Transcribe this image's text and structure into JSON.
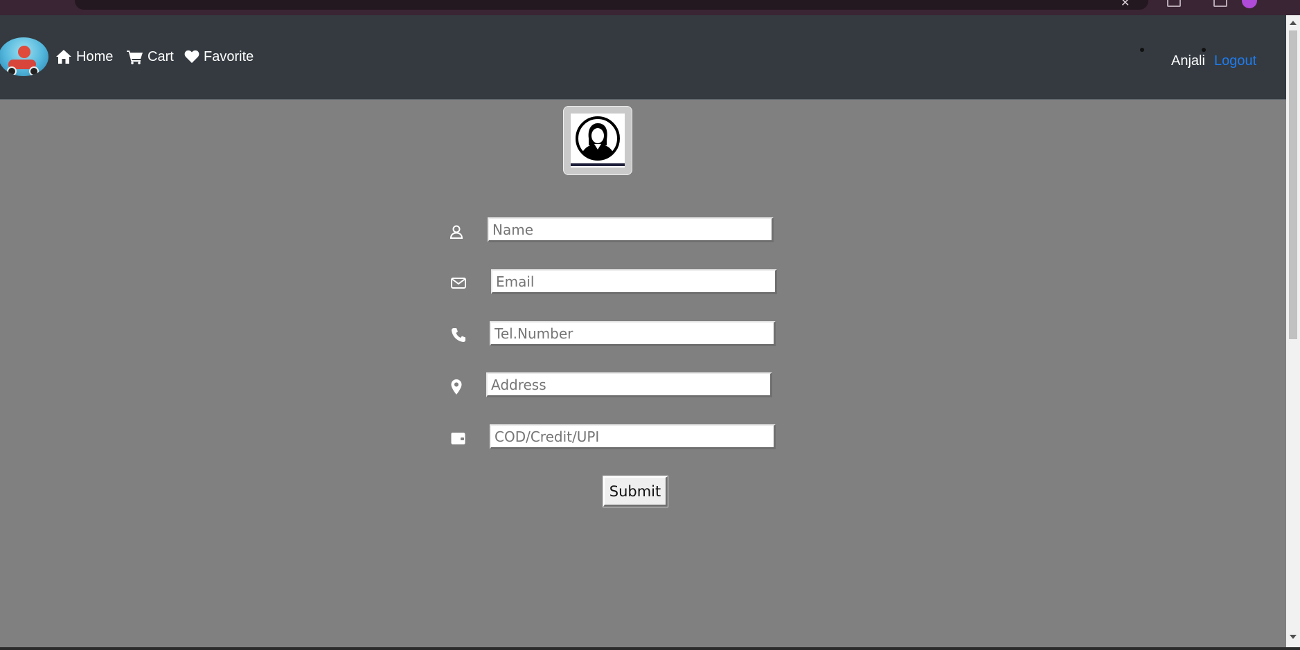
{
  "nav": {
    "home_label": "Home",
    "cart_label": "Cart",
    "favorite_label": "Favorite",
    "user_name": "Anjali",
    "logout_label": "Logout"
  },
  "form": {
    "name_placeholder": "Name",
    "email_placeholder": "Email",
    "phone_placeholder": "Tel.Number",
    "address_placeholder": "Address",
    "payment_placeholder": "COD/Credit/UPI",
    "submit_label": "Submit"
  },
  "icons": {
    "home": "home-icon",
    "cart": "cart-icon",
    "favorite": "heart-icon",
    "name": "user-icon",
    "email": "envelope-icon",
    "phone": "phone-icon",
    "address": "map-pin-icon",
    "payment": "wallet-icon"
  },
  "colors": {
    "navbar_bg": "#343a40",
    "page_bg": "#808080",
    "logout_link": "#1e7cf0"
  }
}
